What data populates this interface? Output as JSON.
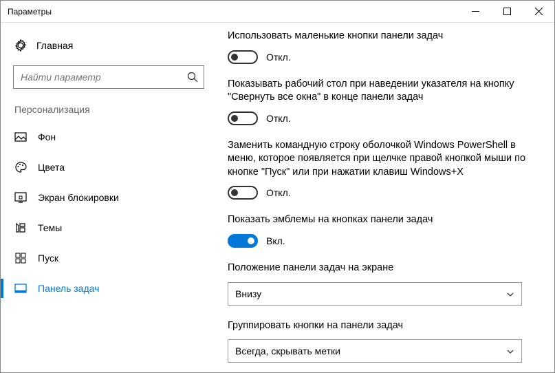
{
  "window": {
    "title": "Параметры"
  },
  "sidebar": {
    "home": "Главная",
    "search_placeholder": "Найти параметр",
    "section": "Персонализация",
    "items": [
      {
        "label": "Фон"
      },
      {
        "label": "Цвета"
      },
      {
        "label": "Экран блокировки"
      },
      {
        "label": "Темы"
      },
      {
        "label": "Пуск"
      },
      {
        "label": "Панель задач"
      }
    ]
  },
  "settings": [
    {
      "label": "Использовать маленькие кнопки панели задач",
      "toggle": false,
      "state_text": "Откл."
    },
    {
      "label": "Показывать рабочий стол при наведении указателя на кнопку \"Свернуть все окна\" в конце панели задач",
      "toggle": false,
      "state_text": "Откл."
    },
    {
      "label": "Заменить командную строку оболочкой Windows PowerShell в меню, которое появляется при щелчке правой кнопкой мыши по кнопке \"Пуск\" или при нажатии клавиш Windows+X",
      "toggle": false,
      "state_text": "Откл."
    },
    {
      "label": "Показать эмблемы на кнопках панели задач",
      "toggle": true,
      "state_text": "Вкл."
    }
  ],
  "dropdowns": [
    {
      "label": "Положение панели задач на экране",
      "value": "Внизу"
    },
    {
      "label": "Группировать кнопки на панели задач",
      "value": "Всегда, скрывать метки"
    }
  ]
}
